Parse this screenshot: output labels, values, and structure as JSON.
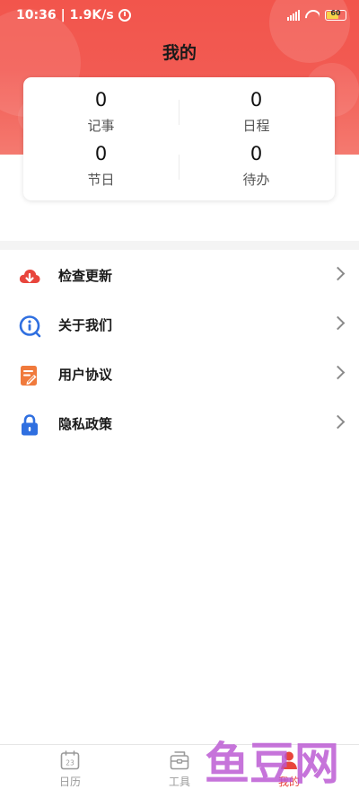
{
  "status_bar": {
    "time": "10:36",
    "speed": "| 1.9K/s",
    "battery": "60"
  },
  "header": {
    "title": "我的"
  },
  "stats": [
    {
      "value": "0",
      "label": "记事"
    },
    {
      "value": "0",
      "label": "日程"
    },
    {
      "value": "0",
      "label": "节日"
    },
    {
      "value": "0",
      "label": "待办"
    }
  ],
  "menu": [
    {
      "label": "检查更新",
      "icon": "cloud-download-icon"
    },
    {
      "label": "关于我们",
      "icon": "info-icon"
    },
    {
      "label": "用户协议",
      "icon": "document-edit-icon"
    },
    {
      "label": "隐私政策",
      "icon": "lock-icon"
    }
  ],
  "tabs": [
    {
      "label": "日历",
      "icon": "calendar-icon",
      "calendar_day": "23"
    },
    {
      "label": "工具",
      "icon": "toolbox-icon"
    },
    {
      "label": "我的",
      "icon": "person-icon",
      "active": true
    }
  ],
  "watermark": "鱼豆网",
  "colors": {
    "header": "#f2554c",
    "accent": "#e8453c",
    "cloud_icon": "#e8453c",
    "info_icon": "#2f6fe0",
    "document_icon": "#f07a3c",
    "lock_icon": "#2f6fe0"
  }
}
